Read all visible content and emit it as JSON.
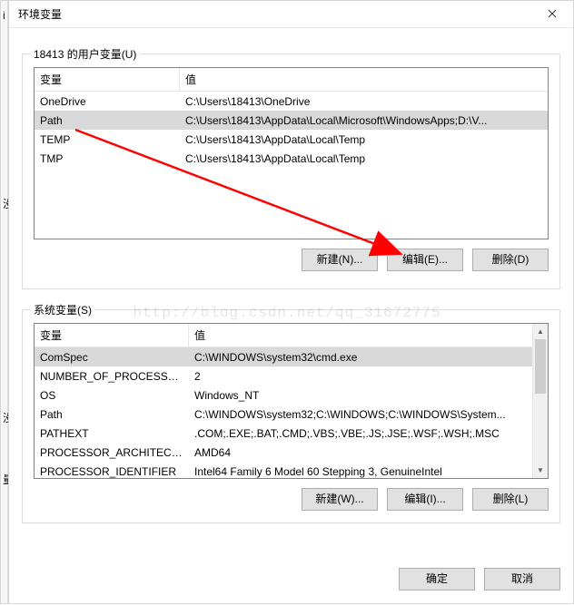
{
  "window": {
    "title": "环境变量"
  },
  "user": {
    "group_label": "18413 的用户变量(U)",
    "headers": {
      "variable": "变量",
      "value": "值"
    },
    "rows": [
      {
        "variable": "OneDrive",
        "value": "C:\\Users\\18413\\OneDrive",
        "selected": false
      },
      {
        "variable": "Path",
        "value": "C:\\Users\\18413\\AppData\\Local\\Microsoft\\WindowsApps;D:\\V...",
        "selected": true
      },
      {
        "variable": "TEMP",
        "value": "C:\\Users\\18413\\AppData\\Local\\Temp",
        "selected": false
      },
      {
        "variable": "TMP",
        "value": "C:\\Users\\18413\\AppData\\Local\\Temp",
        "selected": false
      }
    ],
    "buttons": {
      "new": "新建(N)...",
      "edit": "编辑(E)...",
      "delete": "删除(D)"
    }
  },
  "system": {
    "group_label": "系统变量(S)",
    "headers": {
      "variable": "变量",
      "value": "值"
    },
    "rows": [
      {
        "variable": "ComSpec",
        "value": "C:\\WINDOWS\\system32\\cmd.exe",
        "selected": true
      },
      {
        "variable": "NUMBER_OF_PROCESSORS",
        "value": "2",
        "selected": false
      },
      {
        "variable": "OS",
        "value": "Windows_NT",
        "selected": false
      },
      {
        "variable": "Path",
        "value": "C:\\WINDOWS\\system32;C:\\WINDOWS;C:\\WINDOWS\\System...",
        "selected": false
      },
      {
        "variable": "PATHEXT",
        "value": ".COM;.EXE;.BAT;.CMD;.VBS;.VBE;.JS;.JSE;.WSF;.WSH;.MSC",
        "selected": false
      },
      {
        "variable": "PROCESSOR_ARCHITECT...",
        "value": "AMD64",
        "selected": false
      },
      {
        "variable": "PROCESSOR_IDENTIFIER",
        "value": "Intel64 Family 6 Model 60 Stepping 3, GenuineIntel",
        "selected": false
      }
    ],
    "buttons": {
      "new": "新建(W)...",
      "edit": "编辑(I)...",
      "delete": "删除(L)"
    }
  },
  "dialog_buttons": {
    "ok": "确定",
    "cancel": "取消"
  },
  "watermark": "http://blog.csdn.net/qq_31672775",
  "left_fragments": {
    "a": "i",
    "b": "没",
    "c": "没",
    "d": "量"
  }
}
